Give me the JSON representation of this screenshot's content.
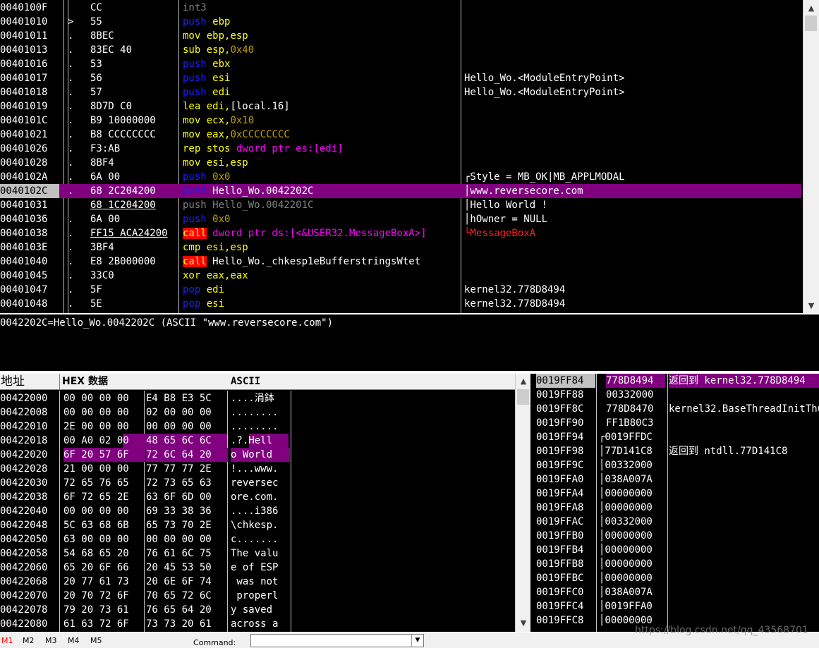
{
  "disasm": [
    {
      "addr": "0040100F",
      "mark": "",
      "hex": "CC",
      "asm": [
        [
          "int3",
          "kg"
        ]
      ],
      "cmt": ""
    },
    {
      "addr": "00401010",
      "mark": ">",
      "hex": "55",
      "asm": [
        [
          "push ",
          "kp"
        ],
        [
          "ebp",
          "km"
        ]
      ],
      "cmt": ""
    },
    {
      "addr": "00401011",
      "mark": ".",
      "hex": "8BEC",
      "asm": [
        [
          "mov ",
          "km"
        ],
        [
          "ebp,esp",
          "km"
        ]
      ],
      "cmt": ""
    },
    {
      "addr": "00401013",
      "mark": ".",
      "hex": "83EC 40",
      "asm": [
        [
          "sub ",
          "km"
        ],
        [
          "esp,",
          "km"
        ],
        [
          "0x40",
          "kn"
        ]
      ],
      "cmt": ""
    },
    {
      "addr": "00401016",
      "mark": ".",
      "hex": "53",
      "asm": [
        [
          "push ",
          "kp"
        ],
        [
          "ebx",
          "km"
        ]
      ],
      "cmt": ""
    },
    {
      "addr": "00401017",
      "mark": ".",
      "hex": "56",
      "asm": [
        [
          "push ",
          "kp"
        ],
        [
          "esi",
          "km"
        ]
      ],
      "cmt": "Hello_Wo.<ModuleEntryPoint>"
    },
    {
      "addr": "00401018",
      "mark": ".",
      "hex": "57",
      "asm": [
        [
          "push ",
          "kp"
        ],
        [
          "edi",
          "km"
        ]
      ],
      "cmt": "Hello_Wo.<ModuleEntryPoint>"
    },
    {
      "addr": "00401019",
      "mark": ".",
      "hex": "8D7D C0",
      "asm": [
        [
          "lea ",
          "km"
        ],
        [
          "edi,",
          "km"
        ],
        [
          "[local.16]",
          "kc"
        ]
      ],
      "cmt": ""
    },
    {
      "addr": "0040101C",
      "mark": ".",
      "hex": "B9 10000000",
      "asm": [
        [
          "mov ",
          "km"
        ],
        [
          "ecx,",
          "km"
        ],
        [
          "0x10",
          "kn"
        ]
      ],
      "cmt": ""
    },
    {
      "addr": "00401021",
      "mark": ".",
      "hex": "B8 CCCCCCCC",
      "asm": [
        [
          "mov ",
          "km"
        ],
        [
          "eax,",
          "km"
        ],
        [
          "0xCCCCCCCC",
          "kn"
        ]
      ],
      "cmt": ""
    },
    {
      "addr": "00401026",
      "mark": ".",
      "hex": "F3:AB",
      "asm": [
        [
          "rep stos ",
          "km"
        ],
        [
          "dword ptr ",
          "kw"
        ],
        [
          "es:[edi]",
          "kw"
        ]
      ],
      "cmt": ""
    },
    {
      "addr": "00401028",
      "mark": ".",
      "hex": "8BF4",
      "asm": [
        [
          "mov ",
          "km"
        ],
        [
          "esi,esp",
          "km"
        ]
      ],
      "cmt": ""
    },
    {
      "addr": "0040102A",
      "mark": ".",
      "hex": "6A 00",
      "asm": [
        [
          "push ",
          "kp"
        ],
        [
          "0x0",
          "kn"
        ]
      ],
      "cmt": "┌Style = MB_OK|MB_APPLMODAL"
    },
    {
      "addr": "0040102C",
      "mark": ".",
      "hex": "68 2C204200",
      "asm": [
        [
          "push ",
          "kp"
        ],
        [
          "Hello_Wo.0042202C",
          "kc"
        ]
      ],
      "cmt": "│www.reversecore.com",
      "sel": true
    },
    {
      "addr": "00401031",
      "mark": "",
      "hex": "68 1C204200",
      "asm": [
        [
          "push Hello_Wo.0042201C",
          "kg"
        ]
      ],
      "cmt": "│Hello World !"
    },
    {
      "addr": "00401036",
      "mark": ".",
      "hex": "6A 00",
      "asm": [
        [
          "push ",
          "kp"
        ],
        [
          "0x0",
          "kn"
        ]
      ],
      "cmt": "│hOwner = NULL"
    },
    {
      "addr": "00401038",
      "mark": ".",
      "hex": "FF15 ACA24200",
      "asm": [
        [
          "call",
          "kcall"
        ],
        [
          " dword ptr ds:[<&USER32.MessageBoxA>]",
          "kw"
        ]
      ],
      "cmt": "└MessageBoxA",
      "cmtRed": true
    },
    {
      "addr": "0040103E",
      "mark": ".",
      "hex": "3BF4",
      "asm": [
        [
          "cmp ",
          "km"
        ],
        [
          "esi,esp",
          "km"
        ]
      ],
      "cmt": ""
    },
    {
      "addr": "00401040",
      "mark": ".",
      "hex": "E8 2B000000",
      "asm": [
        [
          "call",
          "kcall"
        ],
        [
          " Hello_Wo._chkesp1eBufferstringsWtet",
          "kc"
        ]
      ],
      "cmt": ""
    },
    {
      "addr": "00401045",
      "mark": ".",
      "hex": "33C0",
      "asm": [
        [
          "xor ",
          "km"
        ],
        [
          "eax,eax",
          "km"
        ]
      ],
      "cmt": ""
    },
    {
      "addr": "00401047",
      "mark": ".",
      "hex": "5F",
      "asm": [
        [
          "pop ",
          "kp"
        ],
        [
          "edi",
          "km"
        ]
      ],
      "cmt": "kernel32.778D8494"
    },
    {
      "addr": "00401048",
      "mark": ".",
      "hex": "5E",
      "asm": [
        [
          "pop ",
          "kp"
        ],
        [
          "esi",
          "km"
        ]
      ],
      "cmt": "kernel32.778D8494"
    }
  ],
  "info": {
    "text": "0042202C=Hello_Wo.0042202C (ASCII \"www.reversecore.com\")"
  },
  "dump_header": {
    "addr": "地址",
    "hex": "HEX 数据",
    "ascii": "ASCII"
  },
  "dump": [
    {
      "addr": "00422000",
      "h1": "00 00 00 00",
      "h2": "E4 B8 E3 5C",
      "asc": "....涓鉢"
    },
    {
      "addr": "00422008",
      "h1": "00 00 00 00",
      "h2": "02 00 00 00",
      "asc": "........"
    },
    {
      "addr": "00422010",
      "h1": "2E 00 00 00",
      "h2": "00 00 00 00",
      "asc": "........"
    },
    {
      "addr": "00422018",
      "h1": "00 A0 02 00",
      "h2": "48 65 6C 6C",
      "asc": ".?.Hell",
      "hl": "partial"
    },
    {
      "addr": "00422020",
      "h1": "6F 20 57 6F",
      "h2": "72 6C 64 20",
      "asc": "o World ",
      "hl": "full"
    },
    {
      "addr": "00422028",
      "h1": "21 00 00 00",
      "h2": "77 77 77 2E",
      "asc": "!...www."
    },
    {
      "addr": "00422030",
      "h1": "72 65 76 65",
      "h2": "72 73 65 63",
      "asc": "reversec"
    },
    {
      "addr": "00422038",
      "h1": "6F 72 65 2E",
      "h2": "63 6F 6D 00",
      "asc": "ore.com."
    },
    {
      "addr": "00422040",
      "h1": "00 00 00 00",
      "h2": "69 33 38 36",
      "asc": "....i386"
    },
    {
      "addr": "00422048",
      "h1": "5C 63 68 6B",
      "h2": "65 73 70 2E",
      "asc": "\\chkesp."
    },
    {
      "addr": "00422050",
      "h1": "63 00 00 00",
      "h2": "00 00 00 00",
      "asc": "c......."
    },
    {
      "addr": "00422058",
      "h1": "54 68 65 20",
      "h2": "76 61 6C 75",
      "asc": "The valu"
    },
    {
      "addr": "00422060",
      "h1": "65 20 6F 66",
      "h2": "20 45 53 50",
      "asc": "e of ESP"
    },
    {
      "addr": "00422068",
      "h1": "20 77 61 73",
      "h2": "20 6E 6F 74",
      "asc": " was not"
    },
    {
      "addr": "00422070",
      "h1": "20 70 72 6F",
      "h2": "70 65 72 6C",
      "asc": " properl"
    },
    {
      "addr": "00422078",
      "h1": "79 20 73 61",
      "h2": "76 65 64 20",
      "asc": "y saved "
    },
    {
      "addr": "00422080",
      "h1": "61 63 72 6F",
      "h2": "73 73 20 61",
      "asc": "across a"
    }
  ],
  "stack": [
    {
      "addr": "0019FF84",
      "val": "778D8494",
      "cmt": "返回到 kernel32.778D8494",
      "top": true
    },
    {
      "addr": "0019FF88",
      "val": "00332000",
      "cmt": ""
    },
    {
      "addr": "0019FF8C",
      "val": "778D8470",
      "cmt": "kernel32.BaseThreadInitThunk"
    },
    {
      "addr": "0019FF90",
      "val": "FF1B80C3",
      "cmt": ""
    },
    {
      "addr": "0019FF94",
      "val": "┌0019FFDC",
      "cmt": ""
    },
    {
      "addr": "0019FF98",
      "val": "│77D141C8",
      "cmt": "返回到 ntdll.77D141C8"
    },
    {
      "addr": "0019FF9C",
      "val": "│00332000",
      "cmt": ""
    },
    {
      "addr": "0019FFA0",
      "val": "│038A007A",
      "cmt": ""
    },
    {
      "addr": "0019FFA4",
      "val": "│00000000",
      "cmt": ""
    },
    {
      "addr": "0019FFA8",
      "val": "│00000000",
      "cmt": ""
    },
    {
      "addr": "0019FFAC",
      "val": "│00332000",
      "cmt": ""
    },
    {
      "addr": "0019FFB0",
      "val": "│00000000",
      "cmt": ""
    },
    {
      "addr": "0019FFB4",
      "val": "│00000000",
      "cmt": ""
    },
    {
      "addr": "0019FFB8",
      "val": "│00000000",
      "cmt": ""
    },
    {
      "addr": "0019FFBC",
      "val": "│00000000",
      "cmt": ""
    },
    {
      "addr": "0019FFC0",
      "val": "│038A007A",
      "cmt": ""
    },
    {
      "addr": "0019FFC4",
      "val": "│0019FFA0",
      "cmt": ""
    },
    {
      "addr": "0019FFC8",
      "val": "│00000000",
      "cmt": ""
    }
  ],
  "tabs": [
    "M1",
    "M2",
    "M3",
    "M4",
    "M5"
  ],
  "command": {
    "label": "Command:",
    "value": ""
  },
  "watermark": "https://blog.csdn.net/qq_43568701",
  "icons": {
    "scroll_up": "chevron-up-icon",
    "scroll_down": "chevron-down-icon",
    "drop": "dropdown-arrow-icon"
  }
}
